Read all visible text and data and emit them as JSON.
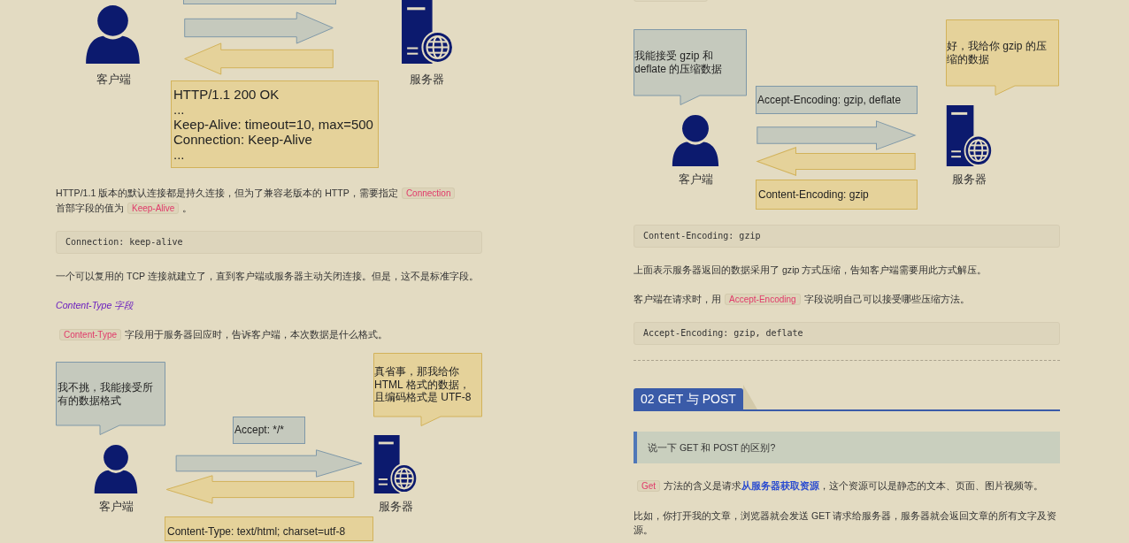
{
  "left_column": [
    {
      "kind": "diagram",
      "client_label": "客户端",
      "server_label": "服务器",
      "response_lines": [
        "HTTP/1.1 200 OK",
        "...",
        "Keep-Alive: timeout=10, max=500",
        "Connection: Keep-Alive",
        "..."
      ]
    },
    {
      "kind": "paragraph",
      "parts": [
        {
          "kind": "text",
          "text": "HTTP/1.1 版本的默认连接都是持久连接，但为了兼容老版本的 HTTP，需要指定"
        },
        {
          "kind": "code",
          "text": "Connection"
        },
        {
          "kind": "text",
          "text": "首部字"
        },
        {
          "kind": "text",
          "text": "段的值为"
        },
        {
          "kind": "code",
          "text": "Keep-Alive"
        },
        {
          "kind": "text",
          "text": "。"
        }
      ]
    },
    {
      "kind": "code_block",
      "text": "Connection: keep-alive"
    },
    {
      "kind": "paragraph",
      "parts": [
        {
          "kind": "text",
          "text": "一个可以复用的 TCP 连接就建立了，直到客户端或服务器主动关闭连接。但是，这不是标准字段。"
        }
      ]
    },
    {
      "kind": "subheading",
      "text": "Content-Type 字段"
    },
    {
      "kind": "paragraph",
      "parts": [
        {
          "kind": "code",
          "text": "Content-Type"
        },
        {
          "kind": "text",
          "text": "字段用于服务器回应时，告诉客户端，本次数据是什么格式。"
        }
      ]
    },
    {
      "kind": "diagram",
      "client_label": "客户端",
      "server_label": "服务器",
      "client_bubble": [
        "我不挑，我能接受所",
        "有的数据格式"
      ],
      "server_bubble": [
        "真省事，那我给你",
        "HTML 格式的数据，",
        "且编码格式是 UTF-8"
      ],
      "request_lines": [
        "Accept: */*"
      ],
      "response_lines": [
        "Content-Type: text/html; charset=utf-8"
      ]
    }
  ],
  "right_column": [
    {
      "kind": "diagram",
      "client_label": "客户端",
      "server_label": "服务器",
      "client_bubble": [
        "我能接受  gzip 和",
        "deflate 的压缩数据"
      ],
      "server_bubble": [
        "好，我给你 gzip 的压",
        "缩的数据"
      ],
      "request_lines": [
        "Accept-Encoding: gzip, deflate"
      ],
      "response_lines": [
        "Content-Encoding: gzip"
      ]
    },
    {
      "kind": "code_block",
      "text": "Content-Encoding: gzip"
    },
    {
      "kind": "paragraph",
      "parts": [
        {
          "kind": "text",
          "text": "上面表示服务器返回的数据采用了 gzip 方式压缩，告知客户端需要用此方式解压。"
        }
      ]
    },
    {
      "kind": "paragraph",
      "parts": [
        {
          "kind": "text",
          "text": "客户端在请求时，用"
        },
        {
          "kind": "code",
          "text": "Accept-Encoding"
        },
        {
          "kind": "text",
          "text": "字段说明自己可以接受哪些压缩方法。"
        }
      ]
    },
    {
      "kind": "code_block",
      "text": "Accept-Encoding: gzip, deflate"
    },
    {
      "kind": "divider"
    },
    {
      "kind": "section_heading",
      "text": "02 GET 与 POST"
    },
    {
      "kind": "quote",
      "text": "说一下 GET 和 POST 的区别?"
    },
    {
      "kind": "paragraph",
      "parts": [
        {
          "kind": "code",
          "text": "Get"
        },
        {
          "kind": "text",
          "text": "方法的含义是请求"
        },
        {
          "kind": "emphasis",
          "text": "从服务器获取资源"
        },
        {
          "kind": "text",
          "text": "，这个资源可以是静态的文本、页面、图片视频等。"
        }
      ]
    },
    {
      "kind": "paragraph",
      "parts": [
        {
          "kind": "text",
          "text": "比如，你打开我的文章，浏览器就会发送 GET 请求给服务器，服务器就会返回文章的所有文字及资"
        },
        {
          "kind": "text",
          "text": "源。"
        }
      ]
    }
  ]
}
